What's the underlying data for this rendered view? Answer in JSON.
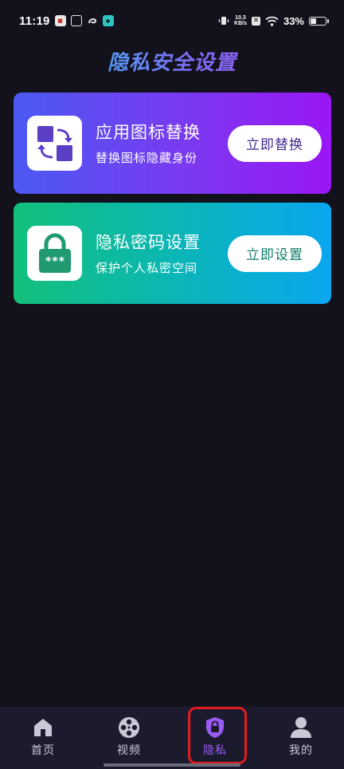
{
  "status_bar": {
    "time": "11:19",
    "net_speed_value": "10.3",
    "net_speed_unit": "KB/s",
    "battery_percent": "33%",
    "battery_level": 0.33
  },
  "page": {
    "title": "隐私安全设置"
  },
  "cards": {
    "icon_change": {
      "title": "应用图标替换",
      "subtitle": "替换图标隐藏身份",
      "button": "立即替换",
      "colors": {
        "from": "#4b59f2",
        "to": "#9a16f5"
      }
    },
    "password": {
      "title": "隐私密码设置",
      "subtitle": "保护个人私密空间",
      "button": "立即设置",
      "lock_text": "***",
      "colors": {
        "from": "#13c07a",
        "to": "#0aa6f0"
      }
    }
  },
  "bottom_nav": {
    "items": [
      {
        "label": "首页",
        "icon": "home-icon"
      },
      {
        "label": "视频",
        "icon": "film-reel-icon"
      },
      {
        "label": "隐私",
        "icon": "shield-lock-icon",
        "active": true
      },
      {
        "label": "我的",
        "icon": "user-icon"
      }
    ]
  },
  "colors": {
    "background": "#12111c",
    "nav_background": "#1c1b2e",
    "active_tab": "#9b5cf6",
    "inactive_tab": "#c9c8d6",
    "highlight_box": "#e11d1d"
  }
}
